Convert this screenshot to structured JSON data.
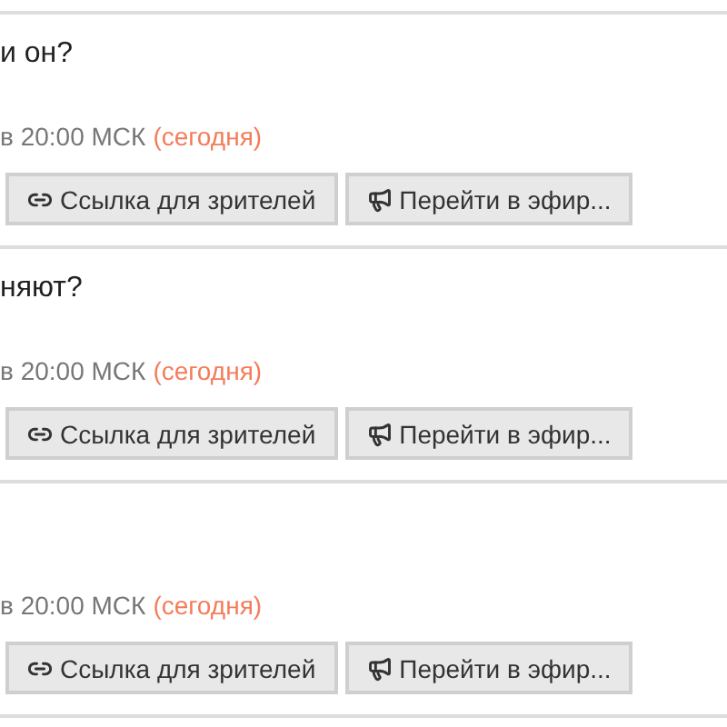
{
  "broadcasts": [
    {
      "title": "и он?",
      "time": "в 20:00 МСК",
      "day": "(сегодня)",
      "buttons": [
        {
          "kind": "link",
          "label": "Ссылка для зрителей"
        },
        {
          "kind": "air",
          "label": "Перейти в эфир..."
        }
      ]
    },
    {
      "title": "няют?",
      "time": "в 20:00 МСК",
      "day": "(сегодня)",
      "buttons": [
        {
          "kind": "link",
          "label": "Ссылка для зрителей"
        },
        {
          "kind": "air",
          "label": "Перейти в эфир..."
        }
      ]
    },
    {
      "time": "в 20:00 МСК",
      "day": "(сегодня)",
      "buttons": [
        {
          "kind": "link",
          "label": "Ссылка для зрителей"
        },
        {
          "kind": "air",
          "label": "Перейти в эфир..."
        }
      ]
    }
  ]
}
